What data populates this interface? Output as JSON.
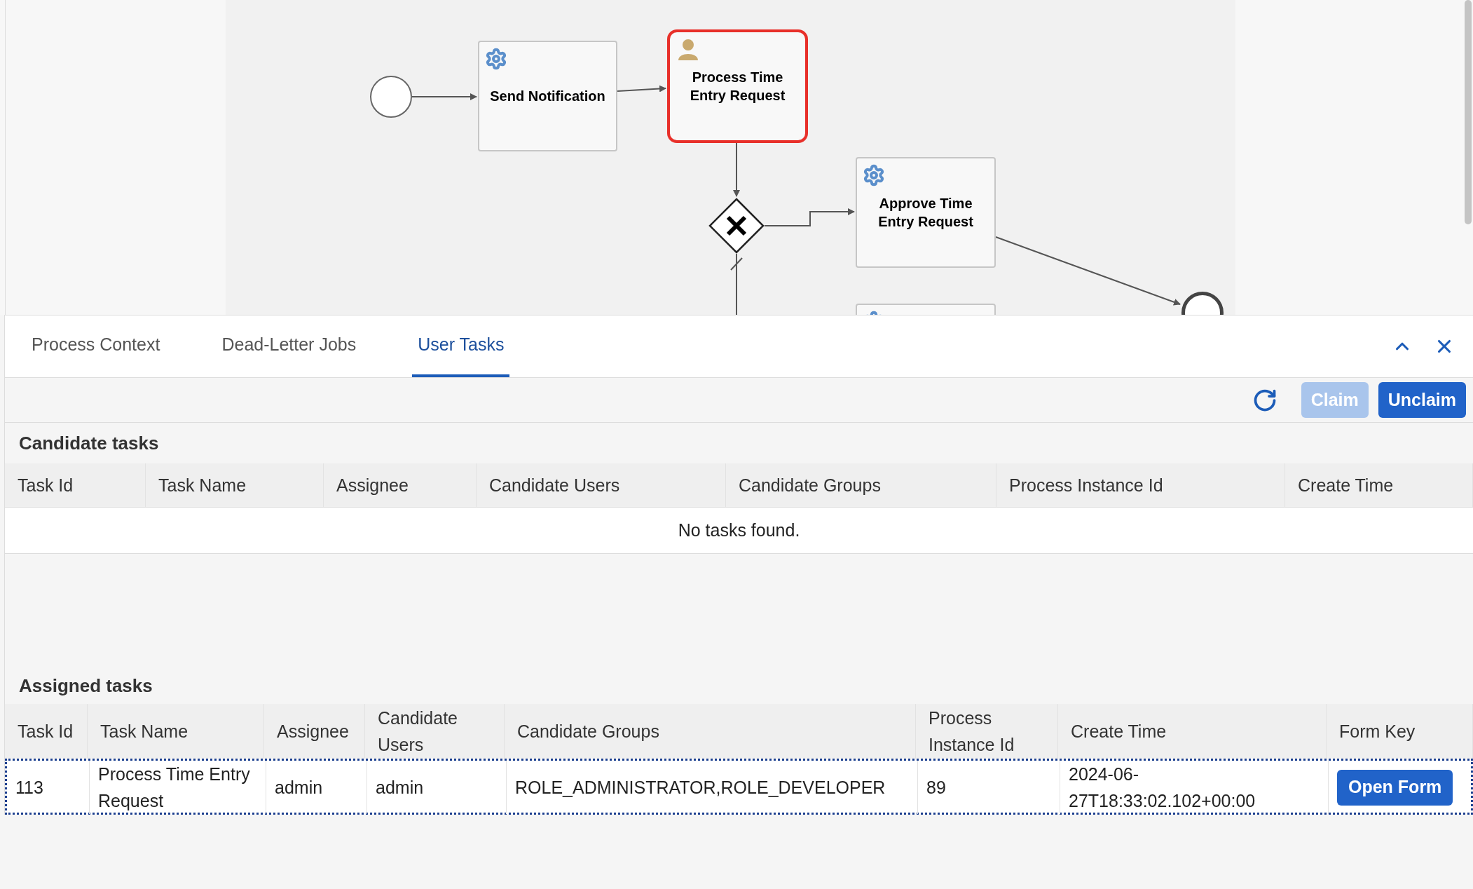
{
  "diagram": {
    "nodes": [
      {
        "kind": "start"
      },
      {
        "kind": "service",
        "label": "Send Notification",
        "selected": false
      },
      {
        "kind": "user",
        "label": "Process Time Entry Request",
        "selected": true
      },
      {
        "kind": "gateway"
      },
      {
        "kind": "service",
        "label": "Approve Time Entry Request",
        "selected": false
      },
      {
        "kind": "end"
      },
      {
        "kind": "service",
        "selected": false
      }
    ]
  },
  "tabs": [
    {
      "label": "Process Context",
      "selected": false
    },
    {
      "label": "Dead-Letter Jobs",
      "selected": false
    },
    {
      "label": "User Tasks",
      "selected": true
    }
  ],
  "toolbar": {
    "buttons": [
      {
        "label": "Claim",
        "disabled": true
      },
      {
        "label": "Unclaim",
        "disabled": false
      }
    ]
  },
  "candidate_tasks": {
    "title": "Candidate tasks",
    "columns": [
      "Task Id",
      "Task Name",
      "Assignee",
      "Candidate Users",
      "Candidate Groups",
      "Process Instance Id",
      "Create Time"
    ],
    "empty_message": "No tasks found."
  },
  "assigned_tasks": {
    "title": "Assigned tasks",
    "columns": [
      "Task Id",
      "Task Name",
      "Assignee",
      "Candidate Users",
      "Candidate Groups",
      "Process Instance Id",
      "Create Time",
      "Form Key"
    ],
    "rows": [
      {
        "selected": true,
        "cells": [
          "113",
          "Process Time Entry Request",
          "admin",
          "admin",
          "ROLE_ADMINISTRATOR,ROLE_DEVELOPER",
          "89",
          "2024-06-27T18:33:02.102+00:00"
        ],
        "form_button": "Open Form"
      }
    ]
  }
}
